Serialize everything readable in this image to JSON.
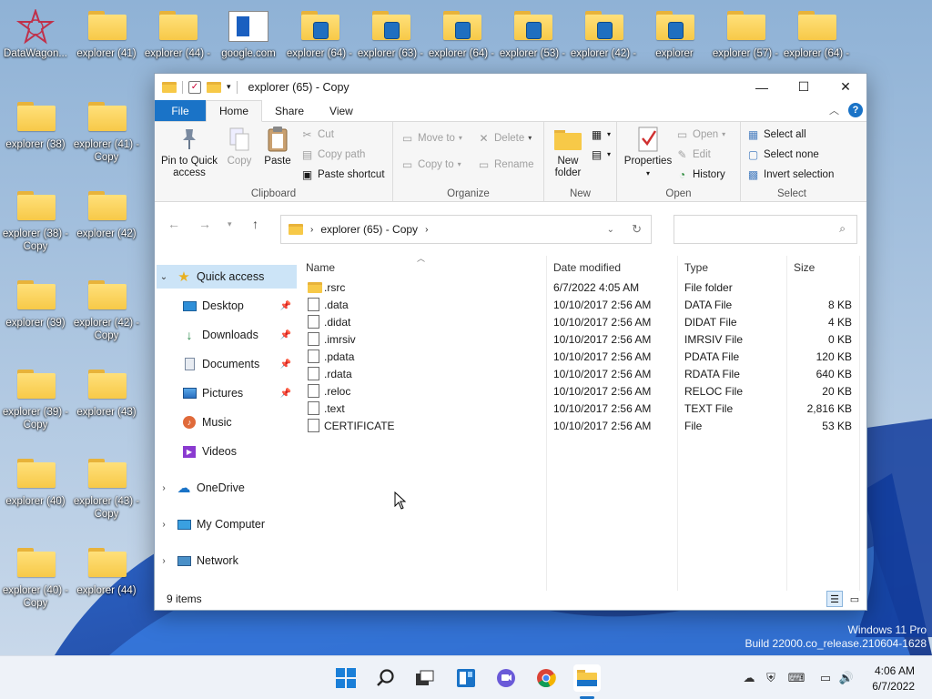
{
  "desktop": {
    "icons_row1": [
      {
        "label": "DataWagon...",
        "kind": "app"
      },
      {
        "label": "explorer (41)",
        "kind": "folder"
      },
      {
        "label": "explorer (44) -",
        "kind": "folder"
      },
      {
        "label": "google.com",
        "kind": "web"
      },
      {
        "label": "explorer (64) -",
        "kind": "folder-badge"
      },
      {
        "label": "explorer (63) -",
        "kind": "folder-badge"
      },
      {
        "label": "explorer (64) -",
        "kind": "folder-badge"
      },
      {
        "label": "explorer (53) -",
        "kind": "folder-badge"
      },
      {
        "label": "explorer (42) -",
        "kind": "folder-badge"
      },
      {
        "label": "explorer",
        "kind": "folder-badge"
      },
      {
        "label": "explorer (57) -",
        "kind": "folder"
      },
      {
        "label": "explorer (64) -",
        "kind": "folder"
      }
    ],
    "icons_col": [
      {
        "label": "explorer (38)",
        "sub": ""
      },
      {
        "label": "explorer (41) -",
        "sub": "Copy"
      },
      {
        "label": "explorer (38) -",
        "sub": "Copy"
      },
      {
        "label": "explorer (42)",
        "sub": ""
      },
      {
        "label": "explorer (39)",
        "sub": ""
      },
      {
        "label": "explorer (42) -",
        "sub": "Copy"
      },
      {
        "label": "explorer (39) -",
        "sub": "Copy"
      },
      {
        "label": "explorer (43)",
        "sub": ""
      },
      {
        "label": "explorer (40)",
        "sub": ""
      },
      {
        "label": "explorer (43) -",
        "sub": "Copy"
      },
      {
        "label": "explorer (40) -",
        "sub": "Copy"
      },
      {
        "label": "explorer (44)",
        "sub": ""
      }
    ],
    "watermark_line1": "Windows 11 Pro",
    "watermark_line2": "Build 22000.co_release.210604-1628"
  },
  "window": {
    "title": "explorer (65) - Copy",
    "controls": {
      "minimize": "—",
      "maximize": "☐",
      "close": "✕"
    },
    "tabs": {
      "file": "File",
      "home": "Home",
      "share": "Share",
      "view": "View"
    },
    "ribbon": {
      "clipboard": {
        "label": "Clipboard",
        "pin": "Pin to Quick\naccess",
        "copy": "Copy",
        "paste": "Paste",
        "cut": "Cut",
        "copy_path": "Copy path",
        "paste_shortcut": "Paste shortcut"
      },
      "organize": {
        "label": "Organize",
        "move_to": "Move to",
        "copy_to": "Copy to",
        "delete": "Delete",
        "rename": "Rename"
      },
      "new": {
        "label": "New",
        "new_folder": "New\nfolder"
      },
      "open": {
        "label": "Open",
        "properties": "Properties",
        "open": "Open",
        "edit": "Edit",
        "history": "History"
      },
      "select": {
        "label": "Select",
        "select_all": "Select all",
        "select_none": "Select none",
        "invert": "Invert selection"
      }
    },
    "address": {
      "path": "explorer (65) - Copy"
    },
    "nav": {
      "quick_access": "Quick access",
      "desktop": "Desktop",
      "downloads": "Downloads",
      "documents": "Documents",
      "pictures": "Pictures",
      "music": "Music",
      "videos": "Videos",
      "onedrive": "OneDrive",
      "mycomputer": "My Computer",
      "network": "Network"
    },
    "columns": {
      "name": "Name",
      "date": "Date modified",
      "type": "Type",
      "size": "Size"
    },
    "files": [
      {
        "name": ".rsrc",
        "date": "6/7/2022 4:05 AM",
        "type": "File folder",
        "size": "",
        "kind": "folder"
      },
      {
        "name": ".data",
        "date": "10/10/2017 2:56 AM",
        "type": "DATA File",
        "size": "8 KB",
        "kind": "file"
      },
      {
        "name": ".didat",
        "date": "10/10/2017 2:56 AM",
        "type": "DIDAT File",
        "size": "4 KB",
        "kind": "file"
      },
      {
        "name": ".imrsiv",
        "date": "10/10/2017 2:56 AM",
        "type": "IMRSIV File",
        "size": "0 KB",
        "kind": "file"
      },
      {
        "name": ".pdata",
        "date": "10/10/2017 2:56 AM",
        "type": "PDATA File",
        "size": "120 KB",
        "kind": "file"
      },
      {
        "name": ".rdata",
        "date": "10/10/2017 2:56 AM",
        "type": "RDATA File",
        "size": "640 KB",
        "kind": "file"
      },
      {
        "name": ".reloc",
        "date": "10/10/2017 2:56 AM",
        "type": "RELOC File",
        "size": "20 KB",
        "kind": "file"
      },
      {
        "name": ".text",
        "date": "10/10/2017 2:56 AM",
        "type": "TEXT File",
        "size": "2,816 KB",
        "kind": "file"
      },
      {
        "name": "CERTIFICATE",
        "date": "10/10/2017 2:56 AM",
        "type": "File",
        "size": "53 KB",
        "kind": "file"
      }
    ],
    "status": {
      "count": "9 items"
    }
  },
  "taskbar": {
    "clock_time": "4:06 AM",
    "clock_date": "6/7/2022"
  },
  "colors": {
    "accent": "#1a73c7",
    "folder": "#f7c948",
    "selection": "#cce4f7"
  }
}
